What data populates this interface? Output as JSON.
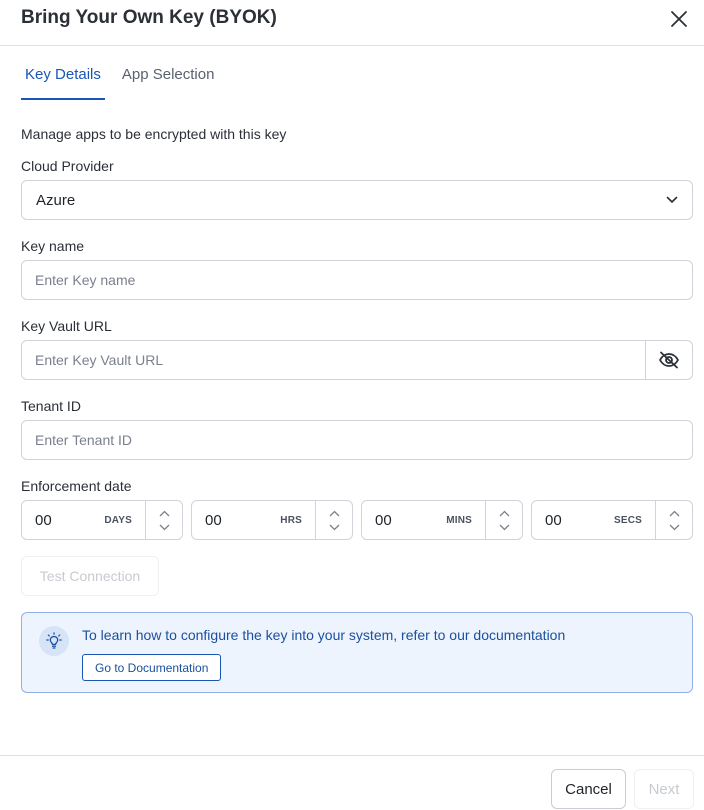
{
  "dialog": {
    "title": "Bring Your Own Key (BYOK)"
  },
  "tabs": [
    {
      "label": "Key Details",
      "active": true
    },
    {
      "label": "App Selection",
      "active": false
    }
  ],
  "form": {
    "description": "Manage apps to be encrypted with this key",
    "cloud_provider": {
      "label": "Cloud Provider",
      "value": "Azure"
    },
    "key_name": {
      "label": "Key name",
      "placeholder": "Enter Key name",
      "value": ""
    },
    "key_vault_url": {
      "label": "Key Vault URL",
      "placeholder": "Enter Key Vault URL",
      "value": ""
    },
    "tenant_id": {
      "label": "Tenant ID",
      "placeholder": "Enter Tenant ID",
      "value": ""
    },
    "enforcement": {
      "label": "Enforcement date",
      "fields": [
        {
          "value": "00",
          "unit": "DAYS"
        },
        {
          "value": "00",
          "unit": "HRS"
        },
        {
          "value": "00",
          "unit": "MINS"
        },
        {
          "value": "00",
          "unit": "SECS"
        }
      ]
    },
    "test_connection_label": "Test Connection"
  },
  "info": {
    "text": "To learn how to configure the key into your system, refer to our documentation",
    "button_label": "Go to Documentation"
  },
  "footer": {
    "cancel_label": "Cancel",
    "next_label": "Next"
  },
  "colors": {
    "accent": "#1a56b5",
    "info_background": "#eef4fd",
    "info_border": "#8fb1e3",
    "disabled_text": "#c7cbd1"
  },
  "icons": [
    "close-icon",
    "chevron-down-icon",
    "eye-off-icon",
    "chevron-up-icon",
    "lightbulb-icon"
  ]
}
